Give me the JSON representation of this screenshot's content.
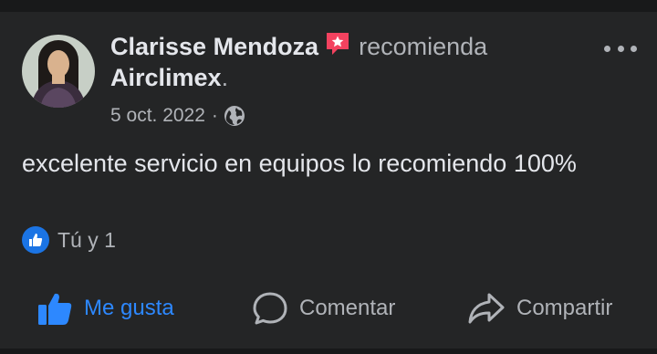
{
  "post": {
    "author": "Clarisse Mendoza",
    "verb": "recomienda",
    "page": "Airclimex",
    "page_suffix": ".",
    "date": "5 oct. 2022",
    "separator": "·",
    "body": "excelente servicio en equipos lo recomiendo 100%",
    "reactions_text": "Tú y 1"
  },
  "icons": {
    "recommend": "recommend-star-icon",
    "privacy": "globe-icon",
    "reaction": "like-reaction-icon",
    "more": "more-options-icon",
    "like": "thumbs-up-icon",
    "comment": "comment-bubble-icon",
    "share": "share-arrow-icon"
  },
  "actions": {
    "like_label": "Me gusta",
    "comment_label": "Comentar",
    "share_label": "Compartir"
  },
  "colors": {
    "background": "#242526",
    "accent": "#2d88ff",
    "recommend": "#f3425f",
    "muted_text": "#b0b3b8"
  }
}
